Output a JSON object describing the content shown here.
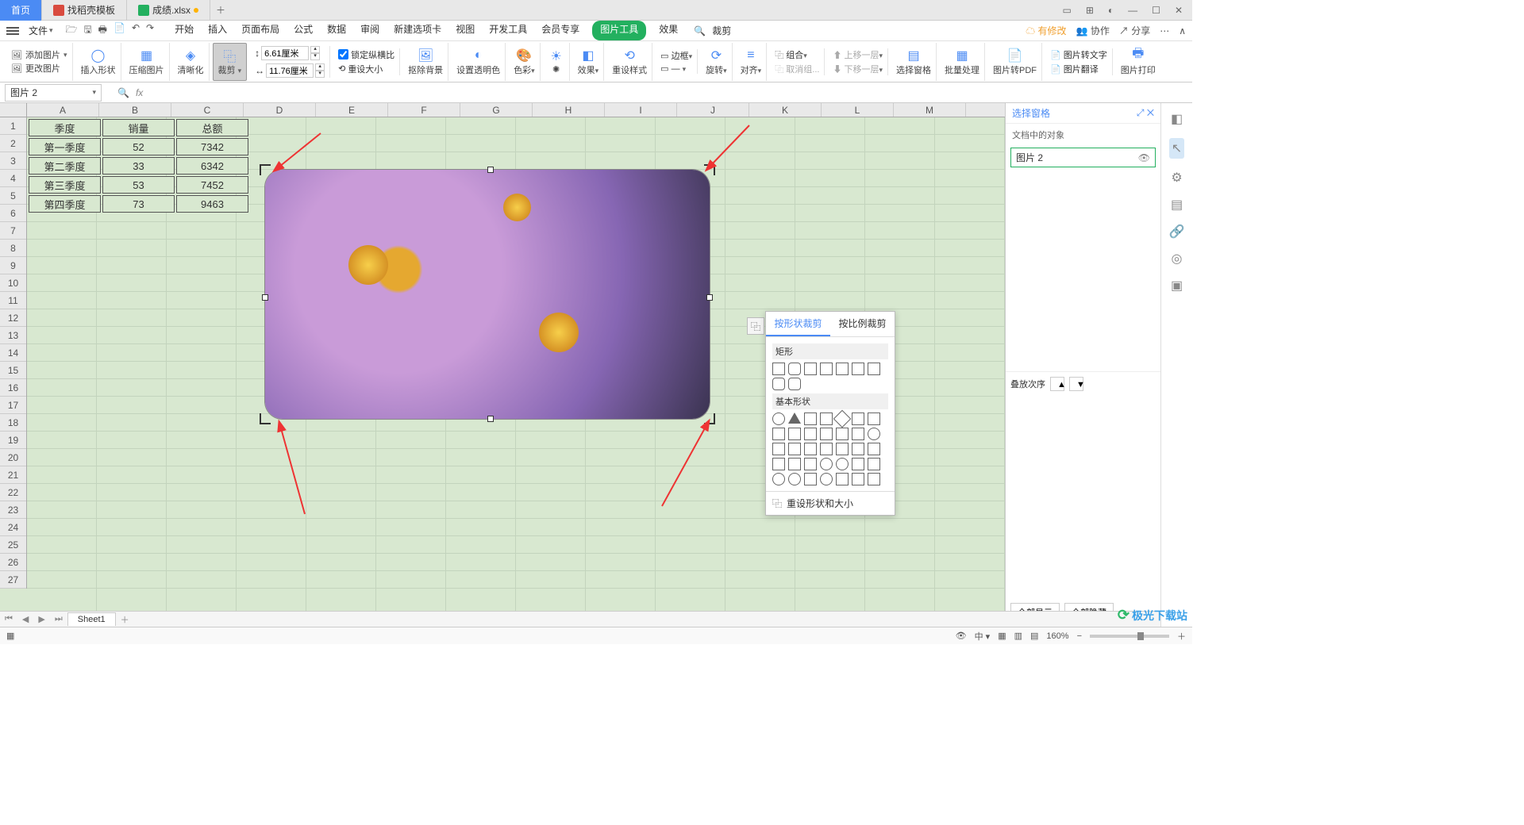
{
  "tabs": {
    "home": "首页",
    "template": "找稻壳模板",
    "file": "成绩.xlsx"
  },
  "menu": {
    "file": "文件",
    "items": [
      "开始",
      "插入",
      "页面布局",
      "公式",
      "数据",
      "审阅",
      "新建选项卡",
      "视图",
      "开发工具",
      "会员专享"
    ],
    "picture_tools": "图片工具",
    "effects": "效果",
    "search_placeholder": "裁剪"
  },
  "topright": {
    "pending": "有修改",
    "collab": "协作",
    "share": "分享"
  },
  "ribbon": {
    "add_pic": "添加图片",
    "change_pic": "更改图片",
    "insert_shape": "插入形状",
    "compress": "压缩图片",
    "sharpen": "清晰化",
    "crop": "裁剪",
    "h_label": "6.61厘米",
    "w_label": "11.76厘米",
    "lock": "锁定纵横比",
    "reset_size": "重设大小",
    "remove_bg": "抠除背景",
    "transparency": "设置透明色",
    "color": "色彩",
    "lumin": "✺",
    "effect": "效果",
    "reset_style": "重设样式",
    "border": "边框",
    "rotate": "旋转",
    "align": "对齐",
    "group": "组合",
    "ungroup": "取消组...",
    "up": "上移一层",
    "down": "下移一层",
    "sel_pane": "选择窗格",
    "batch": "批量处理",
    "to_pdf": "图片转PDF",
    "to_text": "图片转文字",
    "translate": "图片翻译",
    "print": "图片打印"
  },
  "namebox": "图片 2",
  "columns": [
    "A",
    "B",
    "C",
    "D",
    "E",
    "F",
    "G",
    "H",
    "I",
    "J",
    "K",
    "L",
    "M"
  ],
  "chart_data": {
    "type": "table",
    "headers": [
      "季度",
      "销量",
      "总额"
    ],
    "rows": [
      [
        "第一季度",
        "52",
        "7342"
      ],
      [
        "第二季度",
        "33",
        "6342"
      ],
      [
        "第三季度",
        "53",
        "7452"
      ],
      [
        "第四季度",
        "73",
        "9463"
      ]
    ]
  },
  "popup": {
    "tab_shape": "按形状裁剪",
    "tab_ratio": "按比例裁剪",
    "sec_rect": "矩形",
    "sec_basic": "基本形状",
    "reset": "重设形状和大小"
  },
  "selpane": {
    "title": "选择窗格",
    "subtitle": "文档中的对象",
    "item": "图片 2",
    "order": "叠放次序",
    "show_all": "全部显示",
    "hide_all": "全部隐藏"
  },
  "sheet": {
    "name": "Sheet1"
  },
  "status": {
    "zoom": "160%"
  },
  "watermark": "极光下载站"
}
